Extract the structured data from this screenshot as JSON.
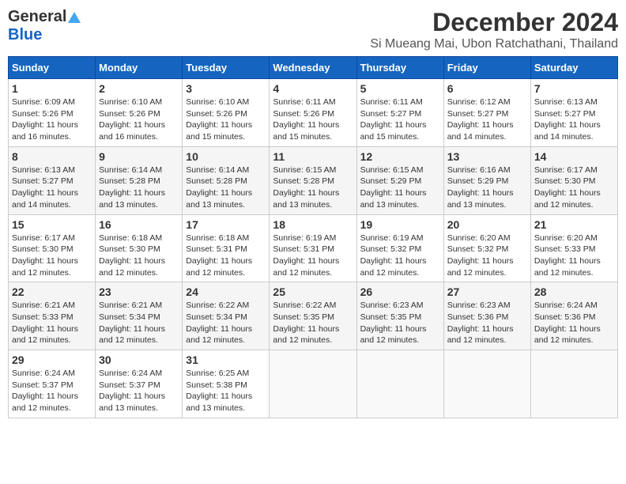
{
  "header": {
    "logo_general": "General",
    "logo_blue": "Blue",
    "title": "December 2024",
    "subtitle": "Si Mueang Mai, Ubon Ratchathani, Thailand"
  },
  "calendar": {
    "weekdays": [
      "Sunday",
      "Monday",
      "Tuesday",
      "Wednesday",
      "Thursday",
      "Friday",
      "Saturday"
    ],
    "weeks": [
      [
        {
          "day": "",
          "info": ""
        },
        {
          "day": "",
          "info": ""
        },
        {
          "day": "",
          "info": ""
        },
        {
          "day": "",
          "info": ""
        },
        {
          "day": "",
          "info": ""
        },
        {
          "day": "",
          "info": ""
        },
        {
          "day": "",
          "info": ""
        }
      ]
    ],
    "days": [
      {
        "week": [
          {
            "day": "1",
            "sunrise": "6:09 AM",
            "sunset": "5:26 PM",
            "daylight": "11 hours and 16 minutes."
          },
          {
            "day": "2",
            "sunrise": "6:10 AM",
            "sunset": "5:26 PM",
            "daylight": "11 hours and 16 minutes."
          },
          {
            "day": "3",
            "sunrise": "6:10 AM",
            "sunset": "5:26 PM",
            "daylight": "11 hours and 15 minutes."
          },
          {
            "day": "4",
            "sunrise": "6:11 AM",
            "sunset": "5:26 PM",
            "daylight": "11 hours and 15 minutes."
          },
          {
            "day": "5",
            "sunrise": "6:11 AM",
            "sunset": "5:27 PM",
            "daylight": "11 hours and 15 minutes."
          },
          {
            "day": "6",
            "sunrise": "6:12 AM",
            "sunset": "5:27 PM",
            "daylight": "11 hours and 14 minutes."
          },
          {
            "day": "7",
            "sunrise": "6:13 AM",
            "sunset": "5:27 PM",
            "daylight": "11 hours and 14 minutes."
          }
        ]
      },
      {
        "week": [
          {
            "day": "8",
            "sunrise": "6:13 AM",
            "sunset": "5:27 PM",
            "daylight": "11 hours and 14 minutes."
          },
          {
            "day": "9",
            "sunrise": "6:14 AM",
            "sunset": "5:28 PM",
            "daylight": "11 hours and 13 minutes."
          },
          {
            "day": "10",
            "sunrise": "6:14 AM",
            "sunset": "5:28 PM",
            "daylight": "11 hours and 13 minutes."
          },
          {
            "day": "11",
            "sunrise": "6:15 AM",
            "sunset": "5:28 PM",
            "daylight": "11 hours and 13 minutes."
          },
          {
            "day": "12",
            "sunrise": "6:15 AM",
            "sunset": "5:29 PM",
            "daylight": "11 hours and 13 minutes."
          },
          {
            "day": "13",
            "sunrise": "6:16 AM",
            "sunset": "5:29 PM",
            "daylight": "11 hours and 13 minutes."
          },
          {
            "day": "14",
            "sunrise": "6:17 AM",
            "sunset": "5:30 PM",
            "daylight": "11 hours and 12 minutes."
          }
        ]
      },
      {
        "week": [
          {
            "day": "15",
            "sunrise": "6:17 AM",
            "sunset": "5:30 PM",
            "daylight": "11 hours and 12 minutes."
          },
          {
            "day": "16",
            "sunrise": "6:18 AM",
            "sunset": "5:30 PM",
            "daylight": "11 hours and 12 minutes."
          },
          {
            "day": "17",
            "sunrise": "6:18 AM",
            "sunset": "5:31 PM",
            "daylight": "11 hours and 12 minutes."
          },
          {
            "day": "18",
            "sunrise": "6:19 AM",
            "sunset": "5:31 PM",
            "daylight": "11 hours and 12 minutes."
          },
          {
            "day": "19",
            "sunrise": "6:19 AM",
            "sunset": "5:32 PM",
            "daylight": "11 hours and 12 minutes."
          },
          {
            "day": "20",
            "sunrise": "6:20 AM",
            "sunset": "5:32 PM",
            "daylight": "11 hours and 12 minutes."
          },
          {
            "day": "21",
            "sunrise": "6:20 AM",
            "sunset": "5:33 PM",
            "daylight": "11 hours and 12 minutes."
          }
        ]
      },
      {
        "week": [
          {
            "day": "22",
            "sunrise": "6:21 AM",
            "sunset": "5:33 PM",
            "daylight": "11 hours and 12 minutes."
          },
          {
            "day": "23",
            "sunrise": "6:21 AM",
            "sunset": "5:34 PM",
            "daylight": "11 hours and 12 minutes."
          },
          {
            "day": "24",
            "sunrise": "6:22 AM",
            "sunset": "5:34 PM",
            "daylight": "11 hours and 12 minutes."
          },
          {
            "day": "25",
            "sunrise": "6:22 AM",
            "sunset": "5:35 PM",
            "daylight": "11 hours and 12 minutes."
          },
          {
            "day": "26",
            "sunrise": "6:23 AM",
            "sunset": "5:35 PM",
            "daylight": "11 hours and 12 minutes."
          },
          {
            "day": "27",
            "sunrise": "6:23 AM",
            "sunset": "5:36 PM",
            "daylight": "11 hours and 12 minutes."
          },
          {
            "day": "28",
            "sunrise": "6:24 AM",
            "sunset": "5:36 PM",
            "daylight": "11 hours and 12 minutes."
          }
        ]
      },
      {
        "week": [
          {
            "day": "29",
            "sunrise": "6:24 AM",
            "sunset": "5:37 PM",
            "daylight": "11 hours and 12 minutes."
          },
          {
            "day": "30",
            "sunrise": "6:24 AM",
            "sunset": "5:37 PM",
            "daylight": "11 hours and 13 minutes."
          },
          {
            "day": "31",
            "sunrise": "6:25 AM",
            "sunset": "5:38 PM",
            "daylight": "11 hours and 13 minutes."
          },
          {
            "day": "",
            "sunrise": "",
            "sunset": "",
            "daylight": ""
          },
          {
            "day": "",
            "sunrise": "",
            "sunset": "",
            "daylight": ""
          },
          {
            "day": "",
            "sunrise": "",
            "sunset": "",
            "daylight": ""
          },
          {
            "day": "",
            "sunrise": "",
            "sunset": "",
            "daylight": ""
          }
        ]
      }
    ]
  }
}
